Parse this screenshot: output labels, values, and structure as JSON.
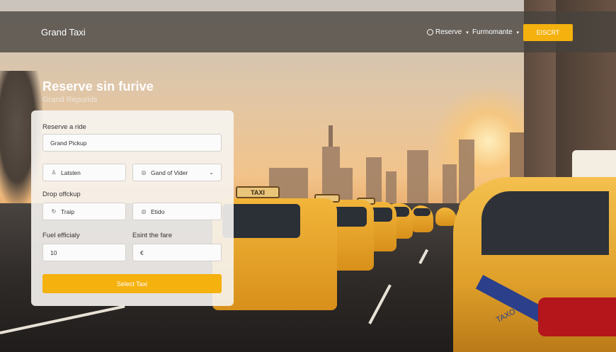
{
  "header": {
    "brand": "Grand Taxi",
    "nav": [
      {
        "label": "Reserve",
        "icon": "chat-bubble-icon"
      },
      {
        "label": "Furmomante"
      }
    ],
    "cta_label": "EISCRT"
  },
  "hero": {
    "title": "Reserve sin furive",
    "subtitle": "Grand Repurids"
  },
  "form": {
    "title": "Reserve a ride",
    "pickup_value": "Grand Pickup",
    "field_a": {
      "value": "Latsten",
      "icon": "user-icon"
    },
    "field_b": {
      "value": "Gand of Vider",
      "icon": "target-icon"
    },
    "dropoff_label": "Drop offckup",
    "field_c": {
      "value": "Traip",
      "icon": "refresh-icon"
    },
    "field_d": {
      "value": "Etido",
      "icon": "target-icon"
    },
    "fuel_label": "Fuel efficialy",
    "fare_label": "Esint the fare",
    "fuel_value": "10",
    "fare_value": "€",
    "submit_label": "Select Taxi"
  },
  "colors": {
    "accent": "#f5b10e",
    "header_bg": "#46423e",
    "card_bg": "#f6f4f1"
  },
  "scene_text": {
    "taxi_sign": "TAXI",
    "door_text": "TAXO"
  }
}
